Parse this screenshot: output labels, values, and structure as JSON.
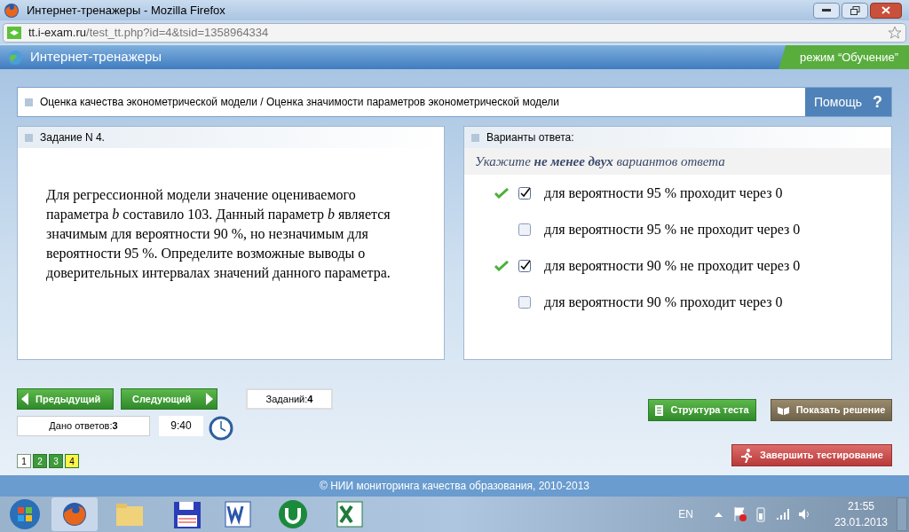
{
  "window": {
    "title": "Интернет-тренажеры - Mozilla Firefox"
  },
  "address_bar": {
    "domain": "tt.i-exam.ru",
    "path": "/test_tt.php?id=4&tsid=1358964334"
  },
  "site_header": {
    "title": "Интернет-тренажеры",
    "mode": "режим “Обучение”"
  },
  "topic": {
    "text": "Оценка качества эконометрической модели / Оценка значимости параметров эконометрической модели",
    "help": "Помощь",
    "help_icon": "?"
  },
  "task": {
    "header": "Задание N 4.",
    "text": "Для регрессионной модели значение оцениваемого параметра *b* составило 103. Данный параметр *b* является значимым для вероятности 90 %, но незначимым для вероятности 95 %. Определите возможные выводы о доверительных интервалах значений данного параметра."
  },
  "answers": {
    "header": "Варианты ответа:",
    "instruction": "Укажите **не менее двух** вариантов ответа",
    "options": [
      {
        "text": "для вероятности 95 % проходит через 0",
        "checked": true,
        "correct": true
      },
      {
        "text": "для вероятности 95 % не проходит через 0",
        "checked": false,
        "correct": false
      },
      {
        "text": "для вероятности 90 % не проходит через 0",
        "checked": true,
        "correct": true
      },
      {
        "text": "для вероятности 90 % проходит через 0",
        "checked": false,
        "correct": false
      }
    ]
  },
  "navigation": {
    "prev": "Предыдущий",
    "next": "Следующий",
    "tasks_label": "Заданий:",
    "tasks_count": "4",
    "answered_label": "Дано ответов:",
    "answered_count": "3",
    "timer": "9:40",
    "pages": [
      {
        "label": "1",
        "answered": false,
        "selected": false
      },
      {
        "label": "2",
        "answered": true,
        "selected": false
      },
      {
        "label": "3",
        "answered": true,
        "selected": false
      },
      {
        "label": "4",
        "answered": true,
        "selected": true
      }
    ]
  },
  "actions": {
    "structure": "Структура теста",
    "solution": "Показать решение",
    "finish": "Завершить тестирование"
  },
  "footer": "© НИИ мониторинга качества образования, 2010-2013",
  "taskbar": {
    "language": "EN",
    "time": "21:55",
    "date": "23.01.2013"
  }
}
